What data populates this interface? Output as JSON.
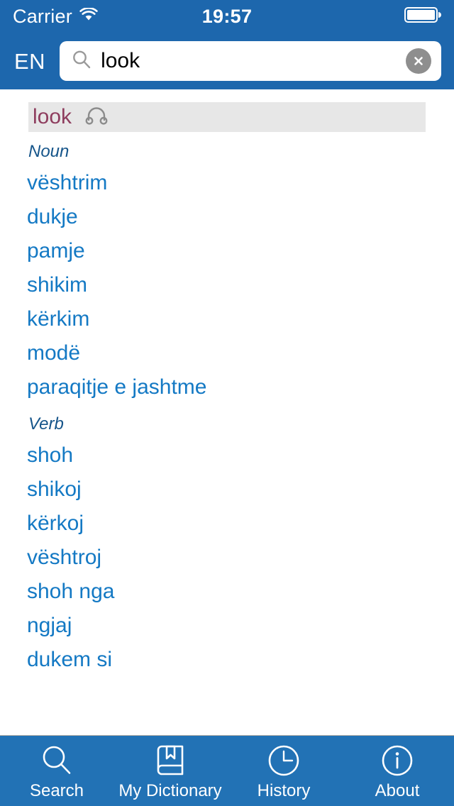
{
  "status_bar": {
    "carrier": "Carrier",
    "wifi_icon": "wifi-icon",
    "time": "19:57",
    "battery_icon": "battery-full-icon"
  },
  "nav_bar": {
    "language": "EN",
    "search": {
      "icon": "search-icon",
      "value": "look",
      "placeholder": "Search",
      "clear_icon": "clear-circle-icon"
    }
  },
  "entry": {
    "headword": "look",
    "audio_icon": "headphones-icon",
    "sections": [
      {
        "pos": "Noun",
        "translations": [
          "vështrim",
          "dukje",
          "pamje",
          "shikim",
          "kërkim",
          "modë",
          "paraqitje e jashtme"
        ]
      },
      {
        "pos": "Verb",
        "translations": [
          "shoh",
          "shikoj",
          "kërkoj",
          "vështroj",
          "shoh nga",
          "ngjaj",
          "dukem si"
        ]
      }
    ]
  },
  "tab_bar": {
    "items": [
      {
        "label": "Search",
        "icon": "magnifier-icon"
      },
      {
        "label": "My Dictionary",
        "icon": "book-bookmark-icon"
      },
      {
        "label": "History",
        "icon": "clock-icon"
      },
      {
        "label": "About",
        "icon": "info-circle-icon"
      }
    ]
  },
  "colors": {
    "header_blue": "#1d67ad",
    "tabbar_blue": "#2272b5",
    "translation_blue": "#1479c4",
    "headword_maroon": "#8e3d5e",
    "pos_navy": "#16558a",
    "headword_band": "#e7e7e7"
  }
}
